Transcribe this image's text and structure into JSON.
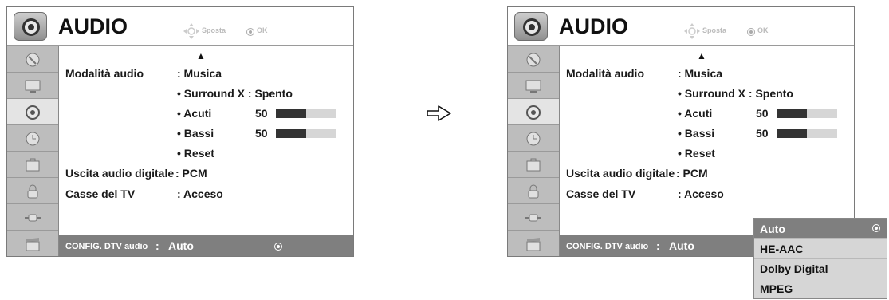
{
  "header": {
    "title": "AUDIO",
    "move_label": "Sposta",
    "ok_label": "OK"
  },
  "sidebar": {
    "icons": [
      "satellite-dish-icon",
      "monitor-icon",
      "audio-icon",
      "clock-icon",
      "toolbox-icon",
      "lock-icon",
      "input-plug-icon",
      "film-clapper-icon"
    ],
    "active_index": 2
  },
  "menu": {
    "up_arrow": "▲",
    "audio_mode": {
      "label": "Modalità audio",
      "value": ": Musica"
    },
    "surround": {
      "label": "• Surround X : Spento"
    },
    "treble": {
      "label": "• Acuti",
      "value": "50",
      "level": 0.5
    },
    "bass": {
      "label": "• Bassi",
      "value": "50",
      "level": 0.5
    },
    "reset": {
      "label": "• Reset"
    },
    "digital_out": {
      "label": "Uscita audio digitale",
      "value": ": PCM"
    },
    "tv_speakers": {
      "label": "Casse del TV",
      "value": ": Acceso"
    },
    "dtv_audio": {
      "label": "CONFIG. DTV audio",
      "colon": " : ",
      "value": "Auto"
    }
  },
  "dropdown": {
    "options": [
      "Auto",
      "HE-AAC",
      "Dolby Digital",
      "MPEG"
    ],
    "selected_index": 0
  },
  "colors": {
    "highlight": "#7f7f7f",
    "sidebar": "#bdbdbd",
    "bar_fill": "#333333",
    "bar_empty": "#d6d6d6"
  }
}
